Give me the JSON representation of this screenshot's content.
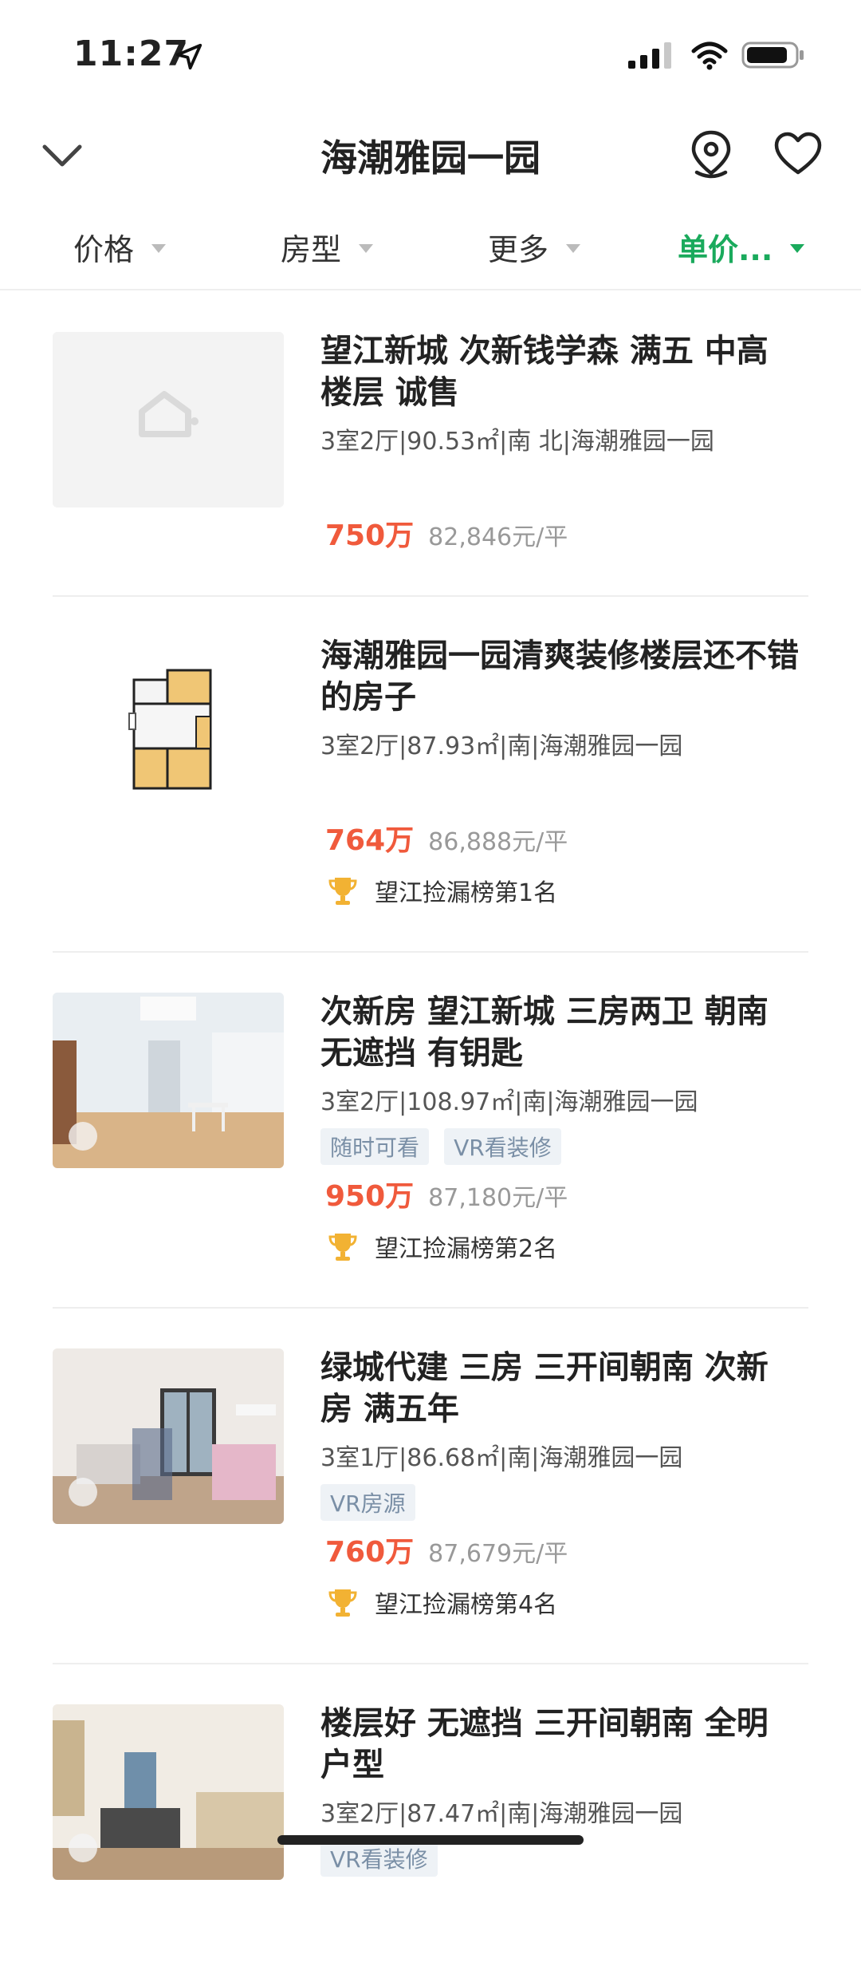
{
  "status_bar": {
    "time": "11:27"
  },
  "header": {
    "title": "海潮雅园一园"
  },
  "filters": [
    {
      "label": "价格",
      "active": false
    },
    {
      "label": "房型",
      "active": false
    },
    {
      "label": "更多",
      "active": false
    },
    {
      "label": "单价...",
      "active": true
    }
  ],
  "listings": [
    {
      "title": "望江新城 次新钱学森 满五 中高楼层 诚售",
      "meta": "3室2厅|90.53㎡|南 北|海潮雅园一园",
      "tags": [],
      "price": "750万",
      "unit_price": "82,846元/平",
      "rank": "",
      "image": "placeholder"
    },
    {
      "title": "海潮雅园一园清爽装修楼层还不错的房子",
      "meta": "3室2厅|87.93㎡|南|海潮雅园一园",
      "tags": [],
      "price": "764万",
      "unit_price": "86,888元/平",
      "rank": "望江捡漏榜第1名",
      "image": "floorplan"
    },
    {
      "title": "次新房 望江新城 三房两卫 朝南无遮挡 有钥匙",
      "meta": "3室2厅|108.97㎡|南|海潮雅园一园",
      "tags": [
        "随时可看",
        "VR看装修"
      ],
      "price": "950万",
      "unit_price": "87,180元/平",
      "rank": "望江捡漏榜第2名",
      "image": "photo"
    },
    {
      "title": "绿城代建 三房 三开间朝南 次新房 满五年",
      "meta": "3室1厅|86.68㎡|南|海潮雅园一园",
      "tags": [
        "VR房源"
      ],
      "price": "760万",
      "unit_price": "87,679元/平",
      "rank": "望江捡漏榜第4名",
      "image": "photo"
    },
    {
      "title": "楼层好 无遮挡 三开间朝南 全明户型",
      "meta": "3室2厅|87.47㎡|南|海潮雅园一园",
      "tags": [
        "VR看装修"
      ],
      "price": "",
      "unit_price": "",
      "rank": "",
      "image": "photo"
    }
  ],
  "colors": {
    "accent": "#1aaa5c",
    "price": "#f05a3c",
    "tag_bg": "#eef2f6",
    "tag_text": "#7a8fa6"
  }
}
